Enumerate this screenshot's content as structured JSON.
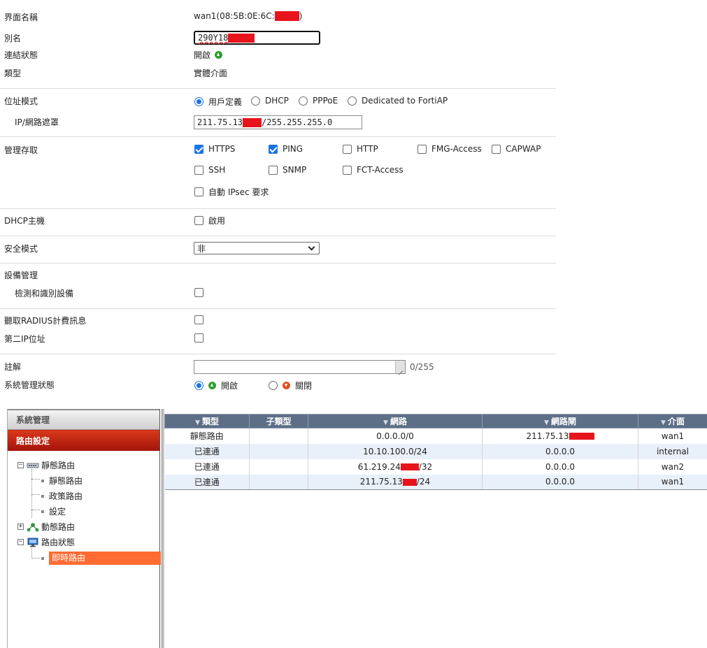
{
  "form": {
    "interface_name_label": "界面名稱",
    "interface_name_prefix": "wan1(08:5B:0E:6C:",
    "interface_name_suffix": ")",
    "alias_label": "別名",
    "alias_value": "290Y18",
    "link_status_label": "連結狀態",
    "link_status_value": "開啟",
    "type_label": "類型",
    "type_value": "實體介面",
    "addressing_label": "位址模式",
    "addressing_options": [
      "用戶定義",
      "DHCP",
      "PPPoE",
      "Dedicated to FortiAP"
    ],
    "addressing_selected": "用戶定義",
    "ip_label": "IP/網路遮罩",
    "ip_prefix": "211.75.13",
    "ip_suffix": "/255.255.255.0",
    "admin_access_label": "管理存取",
    "admin_access": {
      "https": "HTTPS",
      "ping": "PING",
      "http": "HTTP",
      "fmg": "FMG-Access",
      "capwap": "CAPWAP",
      "ssh": "SSH",
      "snmp": "SNMP",
      "fct": "FCT-Access",
      "ipsec": "自動 IPsec 要求"
    },
    "admin_access_checked": [
      "HTTPS",
      "PING"
    ],
    "dhcp_server_label": "DHCP主機",
    "dhcp_server_option": "啟用",
    "security_mode_label": "安全模式",
    "security_mode_value": "非",
    "device_mgmt_label": "設備管理",
    "detect_devices_label": "檢測和識別設備",
    "radius_label": "聽取RADIUS計費訊息",
    "secondary_ip_label": "第二IP位址",
    "comment_label": "註解",
    "comment_counter": "0/255",
    "admin_status_label": "系統管理狀態",
    "admin_status_up": "開啟",
    "admin_status_down": "關閉",
    "admin_status_selected": "開啟"
  },
  "nav": {
    "system": "系統管理",
    "router": "路由設定",
    "static_route_group": "靜態路由",
    "static_route": "靜態路由",
    "policy_route": "政策路由",
    "settings": "設定",
    "dynamic_route": "動態路由",
    "route_status": "路由狀態",
    "realtime_route": "即時路由"
  },
  "routes": {
    "columns": [
      "類型",
      "子類型",
      "網路",
      "網路閘",
      "介面"
    ],
    "rows": [
      {
        "type": "靜態路由",
        "subtype": "",
        "network": "0.0.0.0/0",
        "network_suffix": "",
        "gateway": "211.75.13",
        "gateway_redacted": true,
        "interface": "wan1"
      },
      {
        "type": "已連通",
        "subtype": "",
        "network": "10.10.100.0/24",
        "network_suffix": "",
        "gateway": "0.0.0.0",
        "gateway_redacted": false,
        "interface": "internal"
      },
      {
        "type": "已連通",
        "subtype": "",
        "network": "61.219.24",
        "network_suffix": "/32",
        "gateway": "0.0.0.0",
        "gateway_redacted": false,
        "interface": "wan2"
      },
      {
        "type": "已連通",
        "subtype": "",
        "network": "211.75.13",
        "network_suffix": "/24",
        "gateway": "0.0.0.0",
        "gateway_redacted": false,
        "interface": "wan1"
      }
    ]
  },
  "colors": {
    "accent": "#1a73e8",
    "redaction": "#e8141c",
    "selected_nav": "#ff6b33",
    "header": "#5d6f86"
  }
}
